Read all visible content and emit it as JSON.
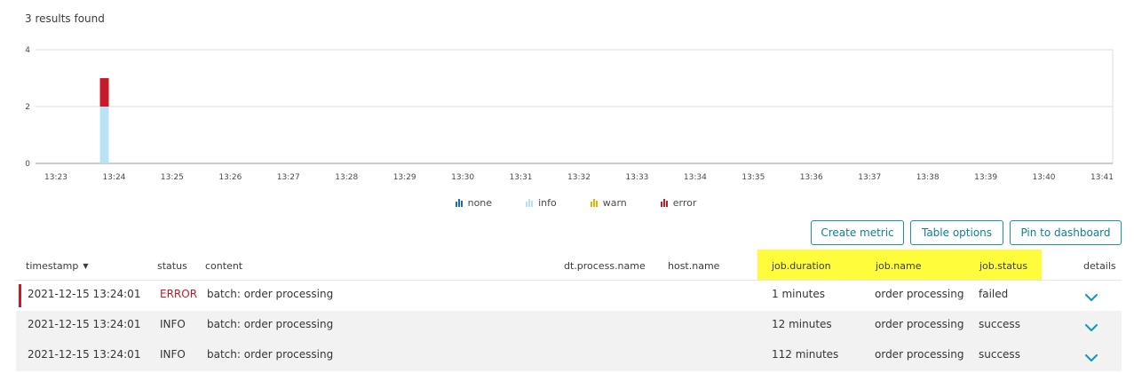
{
  "results": {
    "count_text": "3 results found"
  },
  "chart_data": {
    "type": "bar",
    "stacked": true,
    "categories": [
      "13:23",
      "13:24",
      "13:25",
      "13:26",
      "13:27",
      "13:28",
      "13:29",
      "13:30",
      "13:31",
      "13:32",
      "13:33",
      "13:34",
      "13:35",
      "13:36",
      "13:37",
      "13:38",
      "13:39",
      "13:40",
      "13:41"
    ],
    "yticks": [
      0,
      2,
      4
    ],
    "ylim": [
      0,
      4
    ],
    "series": [
      {
        "name": "none",
        "color": "#1b6fb0",
        "bars": []
      },
      {
        "name": "info",
        "color": "#b9e3f5",
        "bars": [
          {
            "x": "13:23:50",
            "value": 2
          }
        ]
      },
      {
        "name": "warn",
        "color": "#e6b400",
        "bars": []
      },
      {
        "name": "error",
        "color": "#c51a2b",
        "bars": [
          {
            "x": "13:23:50",
            "value": 1
          }
        ]
      }
    ],
    "grid": true
  },
  "legend": [
    {
      "label": "none",
      "icon": "bar-chart-icon",
      "color": "#1b6fb0"
    },
    {
      "label": "info",
      "icon": "bar-chart-icon",
      "color": "#b9e3f5"
    },
    {
      "label": "warn",
      "icon": "bar-chart-icon",
      "color": "#e6b400"
    },
    {
      "label": "error",
      "icon": "bar-chart-icon",
      "color": "#c51a2b"
    }
  ],
  "toolbar": {
    "create_metric": "Create metric",
    "table_options": "Table options",
    "pin_to_dashboard": "Pin to dashboard"
  },
  "table": {
    "columns": {
      "timestamp": "timestamp",
      "sort_indicator": "▼",
      "status": "status",
      "content": "content",
      "process": "dt.process.name",
      "host": "host.name",
      "duration": "job.duration",
      "job_name": "job.name",
      "job_status": "job.status",
      "details": "details"
    },
    "highlight_color": "#fffc3c",
    "rows": [
      {
        "timestamp": "2021-12-15 13:24:01",
        "status": "ERROR",
        "content": "batch: order processing",
        "duration": "1 minutes",
        "job_name": "order processing",
        "job_status": "failed",
        "details_icon": "chevron-down-icon"
      },
      {
        "timestamp": "2021-12-15 13:24:01",
        "status": "INFO",
        "content": "batch: order processing",
        "duration": "12 minutes",
        "job_name": "order processing",
        "job_status": "success",
        "details_icon": "chevron-down-icon"
      },
      {
        "timestamp": "2021-12-15 13:24:01",
        "status": "INFO",
        "content": "batch: order processing",
        "duration": "112 minutes",
        "job_name": "order processing",
        "job_status": "success",
        "details_icon": "chevron-down-icon"
      }
    ]
  }
}
